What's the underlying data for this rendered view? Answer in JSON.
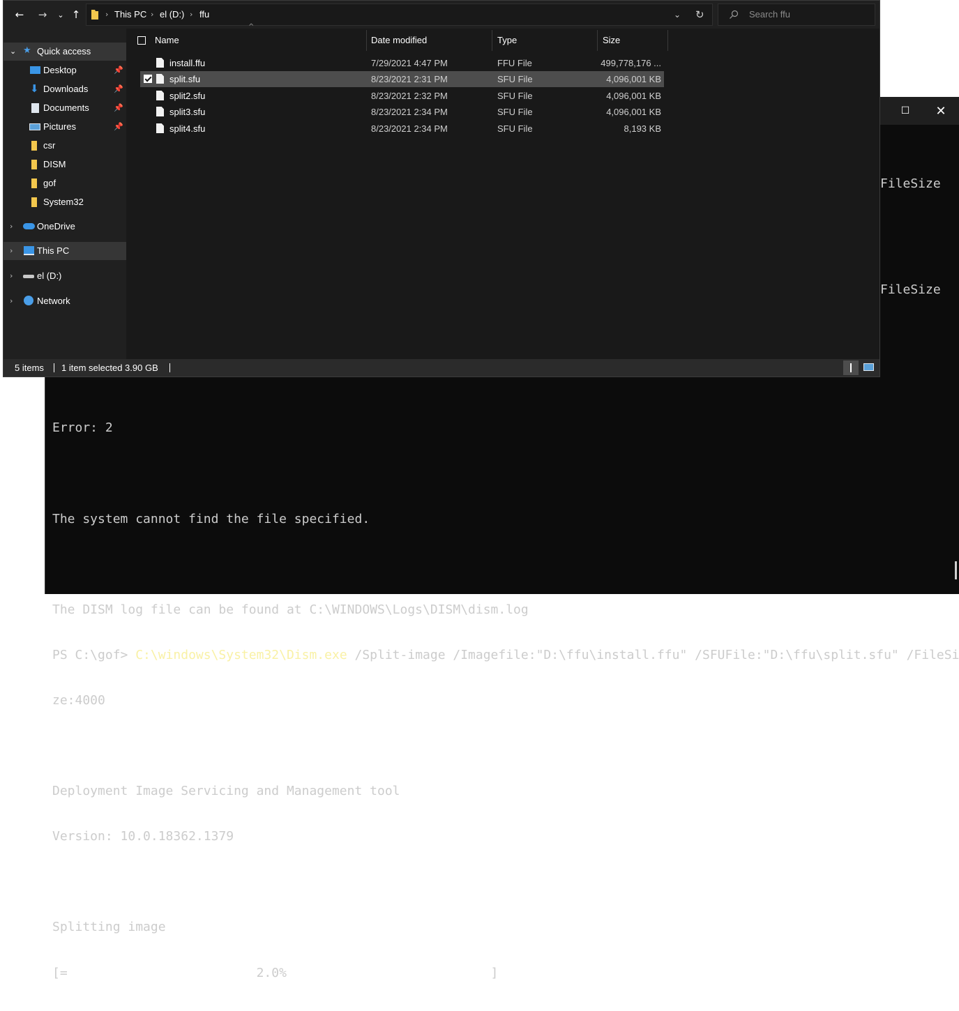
{
  "powershell": {
    "title_buttons": {
      "maximize_icon": "maximize-icon",
      "close_icon": "close-icon"
    },
    "partial_text_1": "FileSize",
    "partial_text_2": "FileSize",
    "lines": {
      "error": "Error: 2",
      "cannot_find": "The system cannot find the file specified.",
      "log": "The DISM log file can be found at C:\\WINDOWS\\Logs\\DISM\\dism.log",
      "prompt": "PS C:\\gof> ",
      "exe": "C:\\windows\\System32\\Dism.exe",
      "args": " /Split-image /Imagefile:\"D:\\ffu\\install.ffu\" /SFUFile:\"D:\\ffu\\split.sfu\" /FileSi",
      "args_cont": "ze:4000",
      "tool": "Deployment Image Servicing and Management tool",
      "version": "Version: 10.0.18362.1379",
      "splitting": "Splitting image",
      "progress": "[=                         2.0%                           ]"
    }
  },
  "explorer": {
    "breadcrumb": [
      "This PC",
      "el (D:)",
      "ffu"
    ],
    "search_placeholder": "Search ffu",
    "nav": {
      "quick_access": "Quick access",
      "items": [
        "Desktop",
        "Downloads",
        "Documents",
        "Pictures",
        "csr",
        "DISM",
        "gof",
        "System32"
      ],
      "onedrive": "OneDrive",
      "this_pc": "This PC",
      "drive": "el (D:)",
      "network": "Network"
    },
    "columns": {
      "name": "Name",
      "date": "Date modified",
      "type": "Type",
      "size": "Size"
    },
    "files": [
      {
        "name": "install.ffu",
        "date": "7/29/2021 4:47 PM",
        "type": "FFU File",
        "size": "499,778,176 ..."
      },
      {
        "name": "split.sfu",
        "date": "8/23/2021 2:31 PM",
        "type": "SFU File",
        "size": "4,096,001 KB"
      },
      {
        "name": "split2.sfu",
        "date": "8/23/2021 2:32 PM",
        "type": "SFU File",
        "size": "4,096,001 KB"
      },
      {
        "name": "split3.sfu",
        "date": "8/23/2021 2:34 PM",
        "type": "SFU File",
        "size": "4,096,001 KB"
      },
      {
        "name": "split4.sfu",
        "date": "8/23/2021 2:34 PM",
        "type": "SFU File",
        "size": "8,193 KB"
      }
    ],
    "status": {
      "count": "5 items",
      "selected": "1 item selected  3.90 GB"
    },
    "colors": {
      "folder": "#f3c74d",
      "accent": "#4a9ee8"
    }
  }
}
